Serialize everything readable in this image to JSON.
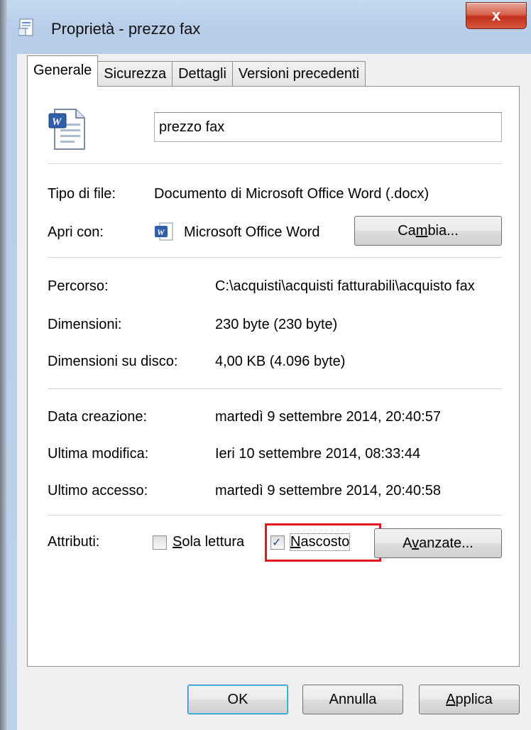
{
  "window": {
    "title": "Proprietà - prezzo fax",
    "close_label": "x",
    "app_icon": "document-properties-icon"
  },
  "tabs": [
    {
      "label": "Generale",
      "active": true
    },
    {
      "label": "Sicurezza",
      "active": false
    },
    {
      "label": "Dettagli",
      "active": false
    },
    {
      "label": "Versioni precedenti",
      "active": false
    }
  ],
  "general": {
    "file_icon": "word-document-icon",
    "file_name": "prezzo fax",
    "file_type_label": "Tipo di file:",
    "file_type_value": "Documento di Microsoft Office Word (.docx)",
    "open_with_label": "Apri con:",
    "open_with_app_icon": "word-app-icon",
    "open_with_value": "Microsoft Office Word",
    "change_button_pre": "Ca",
    "change_button_mnemonic": "m",
    "change_button_post": "bia...",
    "path_label": "Percorso:",
    "path_value": "C:\\acquisti\\acquisti fatturabili\\acquisto fax",
    "size_label": "Dimensioni:",
    "size_value": "230 byte (230 byte)",
    "size_on_disk_label": "Dimensioni su disco:",
    "size_on_disk_value": "4,00 KB (4.096 byte)",
    "created_label": "Data creazione:",
    "created_value": "martedì 9 settembre 2014, 20:40:57",
    "modified_label": "Ultima modifica:",
    "modified_value": "Ieri 10 settembre 2014, 08:33:44",
    "accessed_label": "Ultimo accesso:",
    "accessed_value": "martedì 9 settembre 2014, 20:40:58",
    "attributes_label": "Attributi:",
    "readonly": {
      "mnemonic": "S",
      "rest": "ola lettura",
      "checked": false
    },
    "hidden": {
      "mnemonic": "N",
      "rest": "ascosto",
      "checked": true
    },
    "advanced_button_pre": "A",
    "advanced_button_mnemonic": "v",
    "advanced_button_post": "anzate..."
  },
  "footer": {
    "ok_label": "OK",
    "cancel_label": "Annulla",
    "apply_mnemonic": "A",
    "apply_rest": "pplica"
  },
  "colors": {
    "highlight": "#e0181f",
    "close_button": "#c0301a",
    "frame": "#bcd1ea"
  }
}
